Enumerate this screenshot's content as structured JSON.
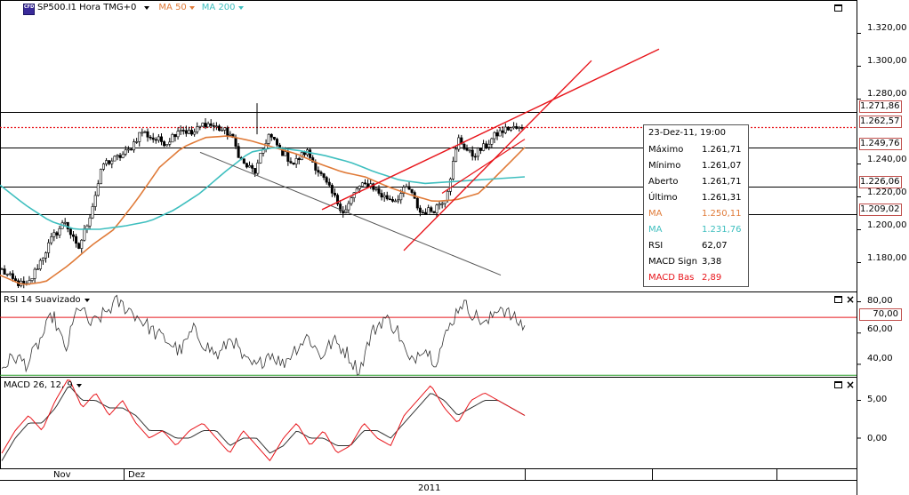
{
  "header": {
    "symbol": "SP500.I1 Hora TMG+0",
    "ma50_label": "MA 50",
    "ma200_label": "MA 200",
    "icon_text": "CFD",
    "colors": {
      "ma50": "#e07b39",
      "ma200": "#3fbfbf",
      "candle": "#000000",
      "trend": "#e8161c",
      "channel": "#555555"
    }
  },
  "chart_data": [
    {
      "type": "candlestick",
      "title": "SP500.I1 Hora TMG+0",
      "ylim": [
        1162,
        1340
      ],
      "yticks": [
        "1.320,00",
        "1.300,00",
        "1.280,00",
        "1.240,00",
        "1.220,00",
        "1.200,00",
        "1.180,00"
      ],
      "price_levels": [
        "1.271,86",
        "1.262,57",
        "1.249,76",
        "1.226,06",
        "1.209,02"
      ],
      "price_level_values": [
        1271.86,
        1262.57,
        1249.76,
        1226.06,
        1209.02
      ],
      "close_anchors": [
        1175,
        1168,
        1165,
        1180,
        1195,
        1205,
        1187,
        1210,
        1240,
        1243,
        1248,
        1260,
        1255,
        1253,
        1262,
        1258,
        1265,
        1262,
        1258,
        1240,
        1235,
        1258,
        1248,
        1240,
        1248,
        1235,
        1222,
        1210,
        1225,
        1228,
        1220,
        1218,
        1226,
        1210,
        1212,
        1220,
        1255,
        1245,
        1250,
        1258,
        1262,
        1261
      ],
      "series": [
        {
          "name": "MA 50",
          "anchors": [
            1172,
            1166,
            1168,
            1178,
            1190,
            1200,
            1218,
            1238,
            1250,
            1256,
            1257,
            1254,
            1250,
            1246,
            1240,
            1235,
            1232,
            1226,
            1221,
            1217,
            1218,
            1222,
            1236,
            1250
          ],
          "value": "1.250,11"
        },
        {
          "name": "MA 200",
          "anchors": [
            1227,
            1215,
            1205,
            1200,
            1200,
            1202,
            1205,
            1212,
            1222,
            1235,
            1247,
            1250,
            1248,
            1245,
            1241,
            1235,
            1230,
            1228,
            1229,
            1230,
            1231,
            1232
          ],
          "value": "1.231,76"
        }
      ],
      "annotations": {
        "horizontal_lines": [
          1271.86,
          1249.76,
          1226.06,
          1209.02
        ],
        "dotted_line": 1262.57
      }
    },
    {
      "type": "line",
      "title": "RSI 14 Suavizado",
      "ylim": [
        32,
        86
      ],
      "yticks": [
        "80,00",
        "60,00",
        "40,00"
      ],
      "level_label": "70,00",
      "levels": [
        70,
        33
      ],
      "anchors": [
        38,
        45,
        40,
        55,
        72,
        48,
        78,
        65,
        72,
        80,
        75,
        68,
        60,
        55,
        48,
        62,
        52,
        45,
        58,
        42,
        38,
        48,
        40,
        50,
        58,
        45,
        55,
        48,
        35,
        60,
        70,
        62,
        40,
        52,
        42,
        62,
        80,
        72,
        65,
        78,
        70,
        64
      ]
    },
    {
      "type": "line",
      "title": "MACD 26, 12, 9",
      "yticks": [
        "5,00",
        "0,00"
      ],
      "ylim": [
        -4,
        8
      ],
      "series": [
        {
          "name": "MACD Bas",
          "anchors": [
            -2,
            1,
            3,
            1,
            5,
            8,
            4,
            6,
            3,
            5,
            2,
            0,
            1,
            -1,
            1,
            2,
            0,
            -2,
            1,
            -1,
            -3,
            0,
            2,
            -1,
            1,
            -2,
            -1,
            2,
            0,
            -1,
            3,
            5,
            7,
            4,
            2,
            5,
            6,
            5,
            4,
            3
          ]
        },
        {
          "name": "MACD Sign",
          "anchors": [
            -3,
            0,
            2,
            2,
            4,
            7,
            5,
            5,
            4,
            4,
            3,
            1,
            1,
            0,
            0,
            1,
            1,
            -1,
            0,
            0,
            -2,
            -1,
            1,
            0,
            0,
            -1,
            -1,
            1,
            1,
            0,
            2,
            4,
            6,
            5,
            3,
            4,
            5,
            5,
            4,
            3
          ]
        }
      ]
    }
  ],
  "info": {
    "date": "23-Dez-11, 19:00",
    "rows": [
      {
        "label": "Máximo",
        "value": "1.261,71",
        "color": "#000000"
      },
      {
        "label": "Mínimo",
        "value": "1.261,07",
        "color": "#000000"
      },
      {
        "label": "Aberto",
        "value": "1.261,71",
        "color": "#000000"
      },
      {
        "label": "Último",
        "value": "1.261,31",
        "color": "#000000"
      },
      {
        "label": "MA",
        "value": "1.250,11",
        "color": "#e07b39"
      },
      {
        "label": "MA",
        "value": "1.231,76",
        "color": "#3fbfbf"
      },
      {
        "label": "RSI",
        "value": "62,07",
        "color": "#000000"
      },
      {
        "label": "MACD Sign",
        "value": "3,38",
        "color": "#000000"
      },
      {
        "label": "MACD Bas",
        "value": "2,89",
        "color": "#e8161c"
      }
    ]
  },
  "x_axis": {
    "labels": [
      "Nov",
      "Dez"
    ],
    "year": "2011"
  }
}
